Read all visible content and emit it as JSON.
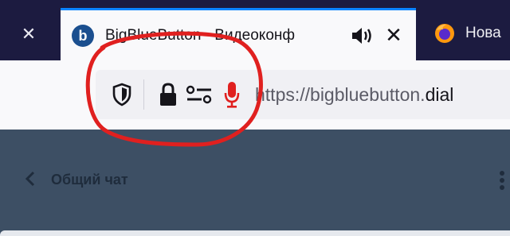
{
  "browser": {
    "tabs": [
      {
        "title": "BigBlueButton - Видеоконф",
        "favicon": "bigbluebutton-logo-icon",
        "active": true,
        "audio_playing": true
      },
      {
        "title": "Нова",
        "favicon": "firefox-logo-icon",
        "active": false
      }
    ],
    "url": {
      "prefix": "https://bigbluebutton.",
      "domain": "dial",
      "icons": [
        "shield-icon",
        "lock-icon",
        "permissions-icon",
        "microphone-icon"
      ]
    }
  },
  "page": {
    "chat_title": "Общий чат",
    "back_icon": "chevron-left-icon",
    "menu_icon": "more-vertical-icon"
  },
  "annotation": {
    "shape": "hand-drawn circle",
    "color": "#e0201f"
  },
  "colors": {
    "tab_strip": "#1c1b40",
    "active_tab_accent": "#0a84ff",
    "microphone": "#e0201f",
    "page_background": "#3d4f64"
  }
}
